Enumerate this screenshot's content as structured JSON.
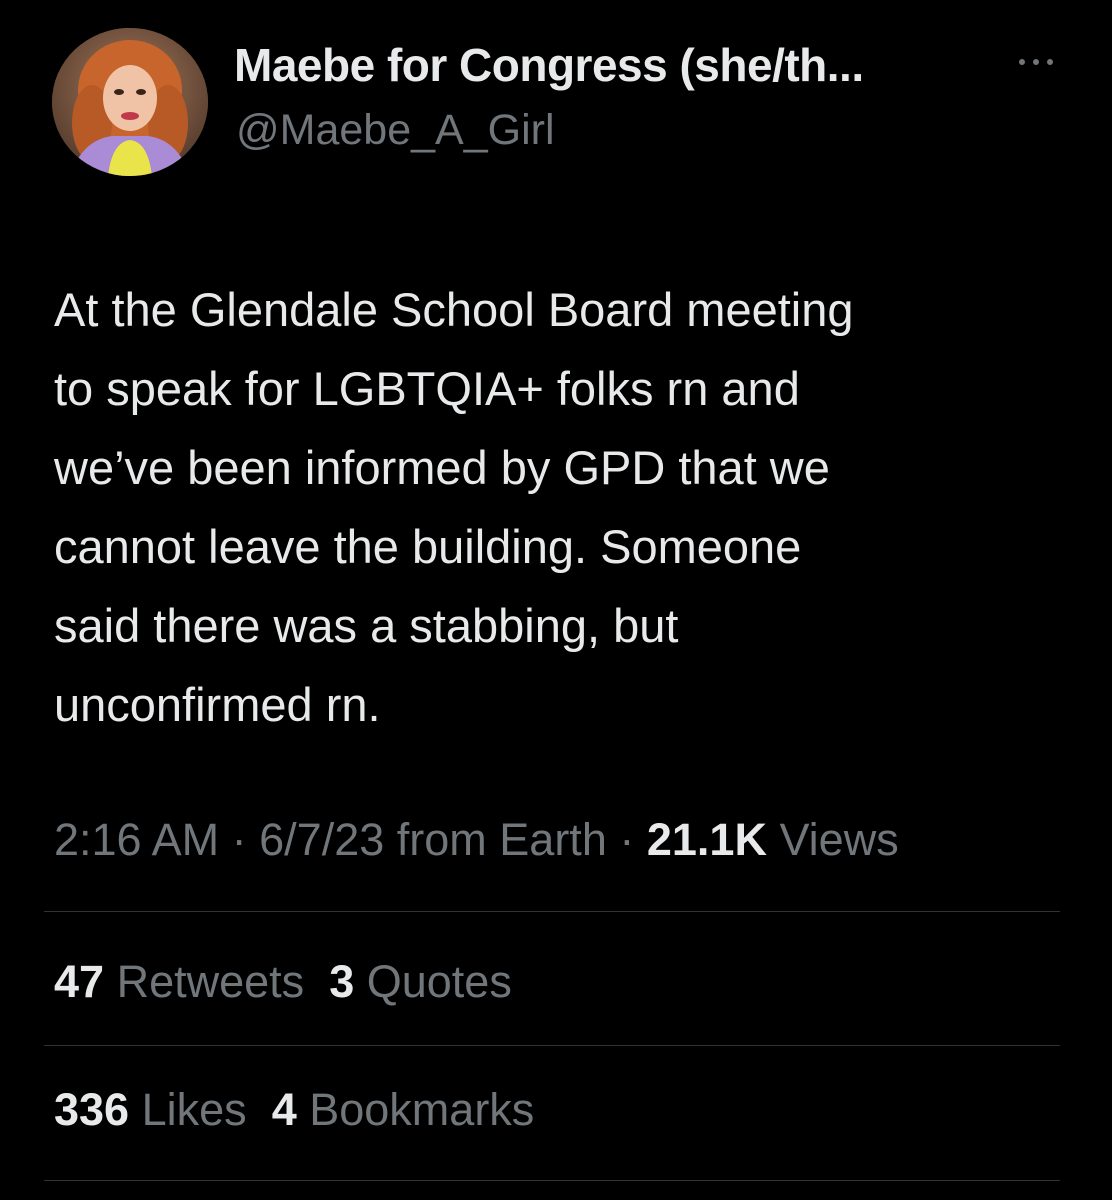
{
  "author": {
    "display_name": "Maebe for Congress (she/th...",
    "handle": "@Maebe_A_Girl",
    "avatar_icon": "profile-photo"
  },
  "menu": {
    "icon": "more-horizontal-icon"
  },
  "tweet": {
    "text": "At the Glendale School Board meeting\nto speak for LGBTQIA+ folks rn and\nwe’ve been informed by GPD that we\ncannot leave the building. Someone\nsaid there was a stabbing, but\nunconfirmed rn.",
    "time": "2:16 AM",
    "separator": "·",
    "date": "6/7/23",
    "source": "from Earth",
    "views_count": "21.1K",
    "views_label": "Views"
  },
  "stats": {
    "retweets_count": "47",
    "retweets_label": "Retweets",
    "quotes_count": "3",
    "quotes_label": "Quotes",
    "likes_count": "336",
    "likes_label": "Likes",
    "bookmarks_count": "4",
    "bookmarks_label": "Bookmarks"
  },
  "colors": {
    "background": "#000000",
    "primary_text": "#e7e9ea",
    "secondary_text": "#71767b",
    "divider": "#2f3336"
  }
}
